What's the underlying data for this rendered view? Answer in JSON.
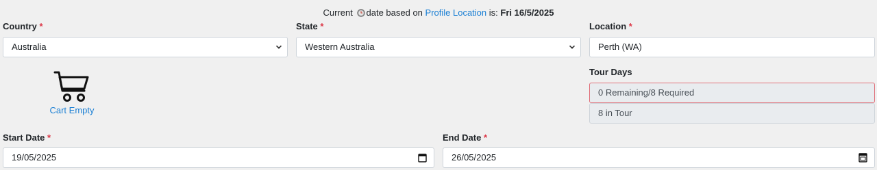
{
  "banner": {
    "prefix": "Current",
    "middle": "date based on",
    "link": "Profile Location",
    "suffix": "is:",
    "date": "Fri 16/5/2025"
  },
  "country": {
    "label": "Country",
    "required": "*",
    "value": "Australia"
  },
  "state": {
    "label": "State",
    "required": "*",
    "value": "Western Australia"
  },
  "location": {
    "label": "Location",
    "required": "*",
    "value": "Perth (WA)"
  },
  "cart": {
    "label": "Cart Empty",
    "icon": "shopping-cart-icon"
  },
  "tour_days": {
    "label": "Tour Days",
    "remaining": "0 Remaining/8 Required",
    "in_tour": "8 in Tour"
  },
  "start_date": {
    "label": "Start Date",
    "required": "*",
    "value": "19/05/2025"
  },
  "end_date": {
    "label": "End Date",
    "required": "*",
    "value": "26/05/2025"
  },
  "colors": {
    "link": "#1a7fd4",
    "required": "#dc3545",
    "invalid_border": "#e0707a"
  }
}
